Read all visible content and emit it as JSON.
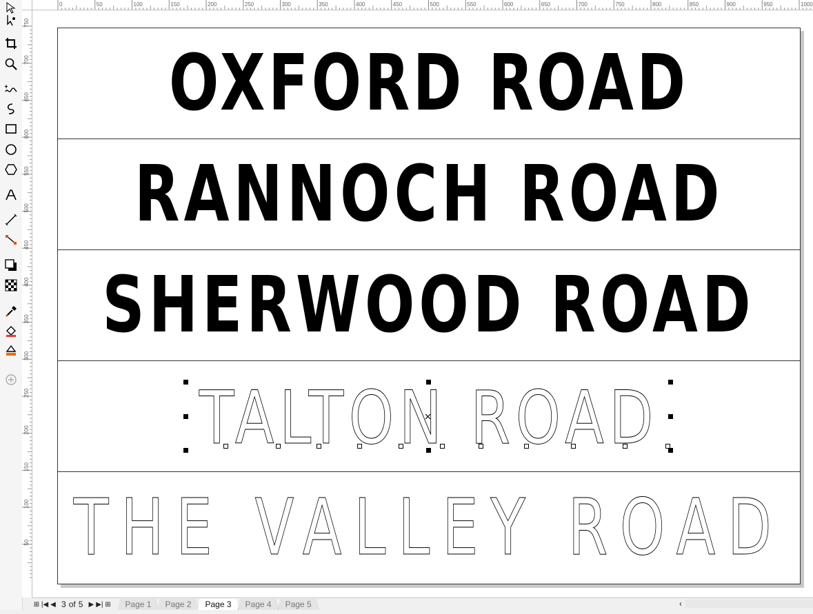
{
  "ruler": {
    "h_labels": [
      "0",
      "50",
      "100",
      "150",
      "200",
      "250",
      "300",
      "350",
      "400",
      "450",
      "500",
      "550",
      "600",
      "650",
      "700",
      "750",
      "800",
      "850",
      "900",
      "950",
      "1000"
    ],
    "v_labels": [
      "750",
      "700",
      "650",
      "600",
      "550",
      "500",
      "450",
      "400",
      "350",
      "300",
      "250",
      "200",
      "150",
      "100",
      "50"
    ]
  },
  "tools": [
    "pick-tool-icon",
    "shape-tool-icon",
    "crop-tool-icon",
    "zoom-tool-icon",
    "freehand-tool-icon",
    "artistic-media-icon",
    "rectangle-tool-icon",
    "ellipse-tool-icon",
    "polygon-tool-icon",
    "text-tool-icon",
    "dimension-tool-icon",
    "connector-tool-icon",
    "drop-shadow-icon",
    "transparency-icon",
    "eyedropper-icon",
    "interactive-fill-icon",
    "smart-fill-icon",
    "add-tool-icon"
  ],
  "signs": [
    {
      "text": "OXFORD ROAD",
      "style": "solid"
    },
    {
      "text": "RANNOCH ROAD",
      "style": "solid"
    },
    {
      "text": "SHERWOOD ROAD",
      "style": "solid"
    },
    {
      "text": "TALTON ROAD",
      "style": "outline",
      "selected": true
    },
    {
      "text": "THE VALLEY ROAD",
      "style": "outline"
    }
  ],
  "page_nav": {
    "current": "3",
    "of": "of",
    "total": "5",
    "tabs": [
      "Page 1",
      "Page 2",
      "Page 3",
      "Page 4",
      "Page 5"
    ],
    "active_tab": "Page 3"
  },
  "colors": {
    "accent": "#1e88e5",
    "ink": "#000000"
  }
}
